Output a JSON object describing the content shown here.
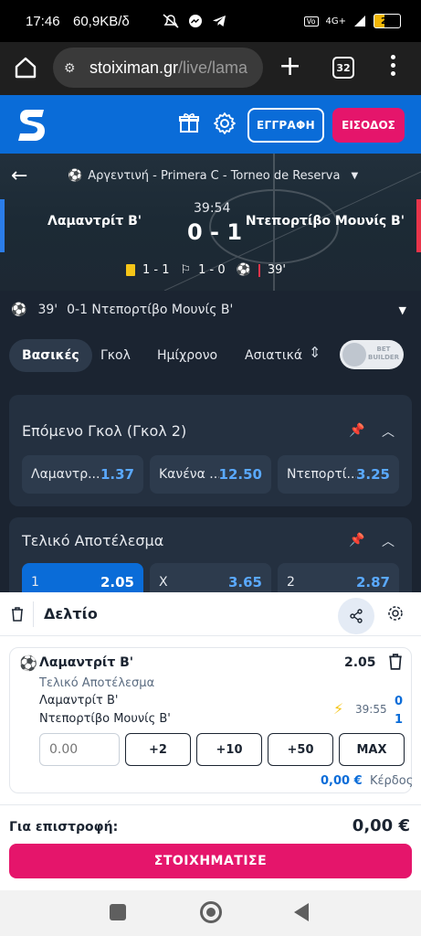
{
  "status_bar": {
    "time": "17:46",
    "speed": "60,9KB/δ",
    "network": "4G+",
    "battery": "20"
  },
  "browser": {
    "url_host": "stoiximan.gr",
    "url_path": "/live/lama",
    "tab_count": "32"
  },
  "site_header": {
    "register_label": "ΕΓΓΡΑΦΗ",
    "login_label": "ΕΙΣΟΔΟΣ",
    "brand_color": "#0a6cd8",
    "accent_color": "#e5156b"
  },
  "match": {
    "league": "Αργεντινή - Primera C - Torneo de Reserva",
    "home_team": "Λαμαντρίτ  Β'",
    "away_team": "Ντεπορτίβο  Μουνίς  Β'",
    "clock": "39:54",
    "score": "0 - 1",
    "yellow_cards": "1 - 1",
    "corners": "1 - 0",
    "minute": "39'"
  },
  "event_row": {
    "minute": "39'",
    "text": "0-1 Ντεπορτίβο Μουνίς Β'"
  },
  "tabs": [
    {
      "label": "Βασικές",
      "active": true
    },
    {
      "label": "Γκολ"
    },
    {
      "label": "Ημίχρονο"
    },
    {
      "label": "Ασιατικά"
    }
  ],
  "bet_builder": {
    "line1": "BET",
    "line2": "BUILDER"
  },
  "markets": [
    {
      "title": "Επόμενο Γκολ (Γκολ 2)",
      "odds": [
        {
          "label": "Λαμαντρ...",
          "value": "1.37"
        },
        {
          "label": "Κανένα ...",
          "value": "12.50"
        },
        {
          "label": "Ντεπορτί...",
          "value": "3.25"
        }
      ]
    },
    {
      "title": "Τελικό Αποτέλεσμα",
      "odds": [
        {
          "label": "1",
          "value": "2.05"
        },
        {
          "label": "X",
          "value": "3.65"
        },
        {
          "label": "2",
          "value": "2.87"
        }
      ]
    }
  ],
  "betslip": {
    "title": "Δελτίο",
    "selection": {
      "team": "Λαμαντρίτ Β'",
      "odd": "2.05",
      "market": "Τελικό Αποτέλεσμα",
      "home": "Λαμαντρίτ Β'",
      "away": "Ντεπορτίβο Μουνίς Β'",
      "clock": "39:55",
      "home_score": "0",
      "away_score": "1"
    },
    "stake_placeholder": "0.00",
    "quick_stakes": [
      "+2",
      "+10",
      "+50",
      "MAX"
    ],
    "win_amount": "0,00 €",
    "win_label": "Κέρδος",
    "returns_label": "Για επιστροφή:",
    "returns_value": "0,00 €",
    "place_bet_label": "ΣΤΟΙΧΗΜΑΤΙΣΕ"
  }
}
